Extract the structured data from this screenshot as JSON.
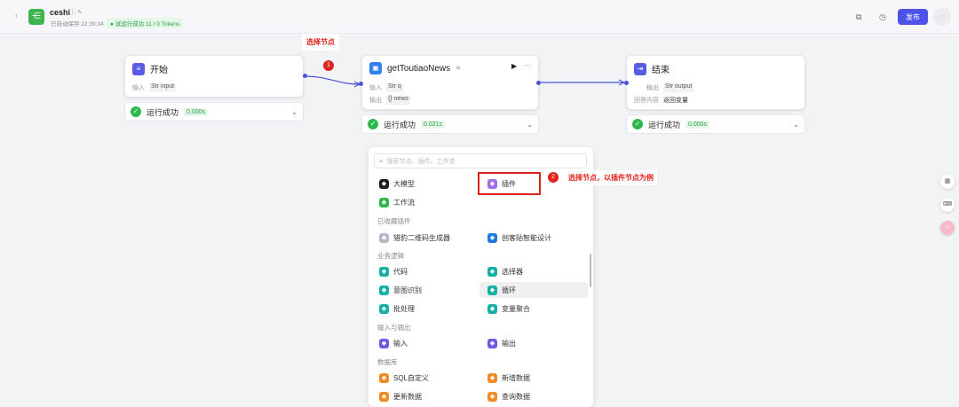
{
  "header": {
    "back_icon": "chevron-left-icon",
    "title": "ceshi",
    "saved": "已自动保存 22:39:34",
    "run_status": "试运行成功 11 / 0 Tokens",
    "publish": "发布",
    "more": "···"
  },
  "nodes": {
    "start": {
      "title": "开始",
      "in_label": "输入",
      "in_type": "Str",
      "in_value": "input",
      "status": "运行成功",
      "time": "0.000s"
    },
    "plugin": {
      "title": "getToutiaoNews",
      "in_label": "输入",
      "in_type": "Str",
      "in_value": "q",
      "out_label": "输出",
      "out_type": "{}",
      "out_value": "news",
      "status": "运行成功",
      "time": "0.021s"
    },
    "end": {
      "title": "结束",
      "out_label": "输出",
      "out_type": "Str",
      "out_value": "output",
      "answer_label": "回答内容",
      "answer_value": "返回变量",
      "status": "运行成功",
      "time": "0.000s"
    }
  },
  "annotations": {
    "step1_num": "1",
    "step1_text": "选择节点",
    "step2_num": "2",
    "step2_text": "选择节点，以插件节点为例"
  },
  "panel": {
    "search_placeholder": "搜索节点、插件、工作流",
    "top": [
      {
        "label": "大模型",
        "color": "#1d1d1f"
      },
      {
        "label": "插件",
        "color": "#a36de8"
      },
      {
        "label": "工作流",
        "color": "#2db84d"
      }
    ],
    "fav_title": "已收藏插件",
    "fav": [
      {
        "label": "猎豹二维码生成器",
        "color": "#b6b8c8"
      },
      {
        "label": "创客贴智能设计",
        "color": "#1f7ae0"
      }
    ],
    "logic_title": "业务逻辑",
    "logic": [
      {
        "label": "代码",
        "color": "#14b0a5"
      },
      {
        "label": "选择器",
        "color": "#14b0a5"
      },
      {
        "label": "意图识别",
        "color": "#14b0a5"
      },
      {
        "label": "循环",
        "color": "#14b0a5"
      },
      {
        "label": "批处理",
        "color": "#14b0a5"
      },
      {
        "label": "变量聚合",
        "color": "#14b0a5"
      }
    ],
    "io_title": "输入与输出",
    "io": [
      {
        "label": "输入",
        "color": "#6b5ce7"
      },
      {
        "label": "输出",
        "color": "#6b5ce7"
      }
    ],
    "db_title": "数据库",
    "db": [
      {
        "label": "SQL自定义",
        "color": "#f08a24"
      },
      {
        "label": "新增数据",
        "color": "#f08a24"
      },
      {
        "label": "更新数据",
        "color": "#f08a24"
      },
      {
        "label": "查询数据",
        "color": "#f08a24"
      }
    ]
  },
  "side": {
    "a": "▦",
    "b": "⌨",
    "c": "☺"
  }
}
